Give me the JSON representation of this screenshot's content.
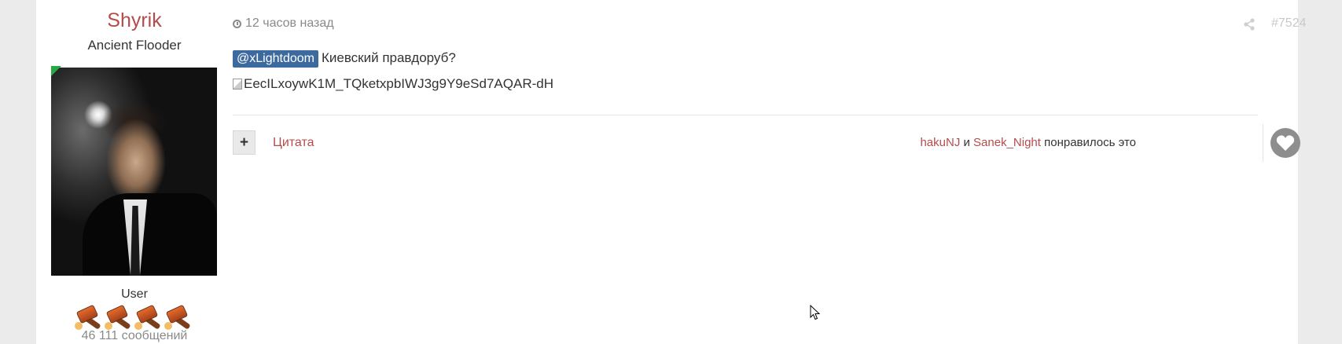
{
  "author": {
    "name": "Shyrik",
    "title": "Ancient Flooder",
    "rank": "User",
    "post_count": "46 111 сообщений",
    "online": true
  },
  "post": {
    "timestamp": "12 часов назад",
    "number": "#7524",
    "mention": "@xLightdoom",
    "text": "Киевский правдоруб?",
    "broken_image_alt": "EecILxoywK1M_TQketxpbIWJ3g9Y9eSd7AQAR-dH"
  },
  "footer": {
    "plus_label": "+",
    "quote_label": "Цитата",
    "likes": {
      "user1": "hakuNJ",
      "conjunction": " и ",
      "user2": "Sanek_Night",
      "suffix": " понравилось это"
    }
  },
  "colors": {
    "accent": "#b54c4c",
    "mention_bg": "#3d6a9e",
    "online": "#28a745",
    "page_bg": "#ebebeb"
  },
  "icons": [
    "clock-icon",
    "share-icon",
    "heart-icon",
    "plus-icon",
    "broken-image-icon",
    "gavel-icon",
    "mouse-cursor-icon"
  ]
}
